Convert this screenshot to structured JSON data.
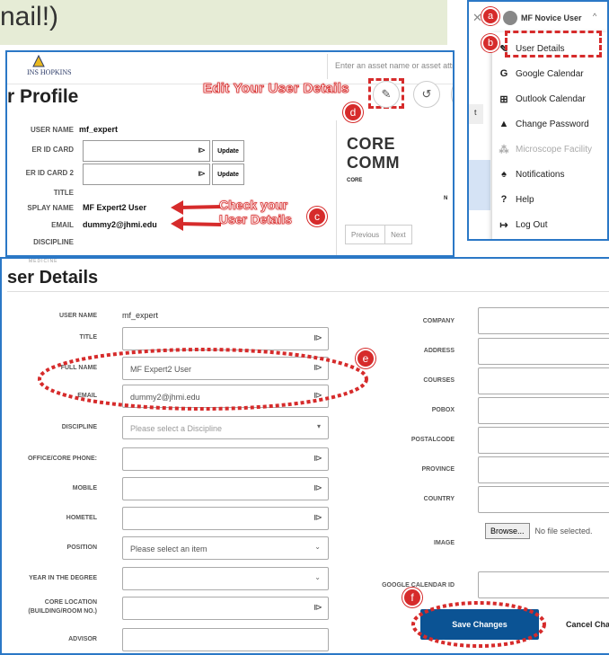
{
  "banner": {
    "text": "nail!)"
  },
  "profile": {
    "brand": "INS HOPKINS",
    "search_placeholder": "Enter an asset name or asset attrib",
    "title": "r Profile",
    "edit_note": "Edit Your User Details",
    "fields": [
      {
        "label": "USER NAME",
        "value": "mf_expert"
      },
      {
        "label": "ER ID CARD",
        "value": ""
      },
      {
        "label": "ER ID CARD 2",
        "value": ""
      },
      {
        "label": "TITLE",
        "value": ""
      },
      {
        "label": "SPLAY NAME",
        "value": "MF Expert2 User"
      },
      {
        "label": "EMAIL",
        "value": "dummy2@jhmi.edu"
      },
      {
        "label": "DISCIPLINE",
        "value": ""
      }
    ],
    "update_label": "Update",
    "core_title": "CORE COMM",
    "core_col": "CORE",
    "core_n": "N",
    "pager": [
      "Previous",
      "Next"
    ],
    "check_note": [
      "Check your",
      "User Details"
    ]
  },
  "menu": {
    "user": "MF Novice User",
    "items": [
      {
        "icon": "pencil-icon",
        "label": "User Details",
        "enabled": true
      },
      {
        "icon": "google-icon",
        "label": "Google Calendar",
        "enabled": true
      },
      {
        "icon": "windows-icon",
        "label": "Outlook Calendar",
        "enabled": true
      },
      {
        "icon": "lock-icon",
        "label": "Change Password",
        "enabled": true
      },
      {
        "icon": "group-icon",
        "label": "Microscope Facility",
        "enabled": false
      },
      {
        "icon": "bell-icon",
        "label": "Notifications",
        "enabled": true
      },
      {
        "icon": "help-icon",
        "label": "Help",
        "enabled": true
      },
      {
        "icon": "logout-icon",
        "label": "Log Out",
        "enabled": true
      }
    ],
    "left_fragment": "t"
  },
  "badges": {
    "a": "a",
    "b": "b",
    "c": "c",
    "d": "d",
    "e": "e",
    "f": "f"
  },
  "user_details": {
    "subtitle": "MEDICINE",
    "title": "ser Details",
    "left": [
      {
        "label": "USER NAME",
        "type": "text",
        "value": "mf_expert"
      },
      {
        "label": "TITLE",
        "type": "input",
        "value": ""
      },
      {
        "label": "FULL NAME",
        "type": "input",
        "value": "MF Expert2 User"
      },
      {
        "label": "EMAIL",
        "type": "input",
        "value": "dummy2@jhmi.edu"
      },
      {
        "label": "DISCIPLINE",
        "type": "select",
        "value": "Please select a Discipline"
      },
      {
        "label": "OFFICE/CORE PHONE:",
        "type": "input",
        "value": ""
      },
      {
        "label": "MOBILE",
        "type": "input",
        "value": ""
      },
      {
        "label": "HOMETEL",
        "type": "input",
        "value": ""
      },
      {
        "label": "POSITION",
        "type": "select",
        "value": "Please select an item"
      },
      {
        "label": "YEAR IN THE DEGREE",
        "type": "select",
        "value": ""
      },
      {
        "label": "CORE LOCATION\n(BUILDING/ROOM NO.)",
        "type": "input",
        "value": ""
      },
      {
        "label": "ADVISOR",
        "type": "input",
        "value": ""
      }
    ],
    "right": [
      {
        "label": "COMPANY"
      },
      {
        "label": "ADDRESS"
      },
      {
        "label": "COURSES"
      },
      {
        "label": "POBOX"
      },
      {
        "label": "POSTALCODE"
      },
      {
        "label": "PROVINCE"
      },
      {
        "label": "COUNTRY"
      },
      {
        "label": "IMAGE"
      },
      {
        "label": "GOOGLE CALENDAR ID"
      }
    ],
    "browse_label": "Browse...",
    "file_status": "No file selected.",
    "save_label": "Save Changes",
    "cancel_label": "Cancel Cha"
  },
  "colors": {
    "accent": "#2b78c6",
    "annotation": "#d62b2b",
    "primary_button": "#0b5394"
  }
}
